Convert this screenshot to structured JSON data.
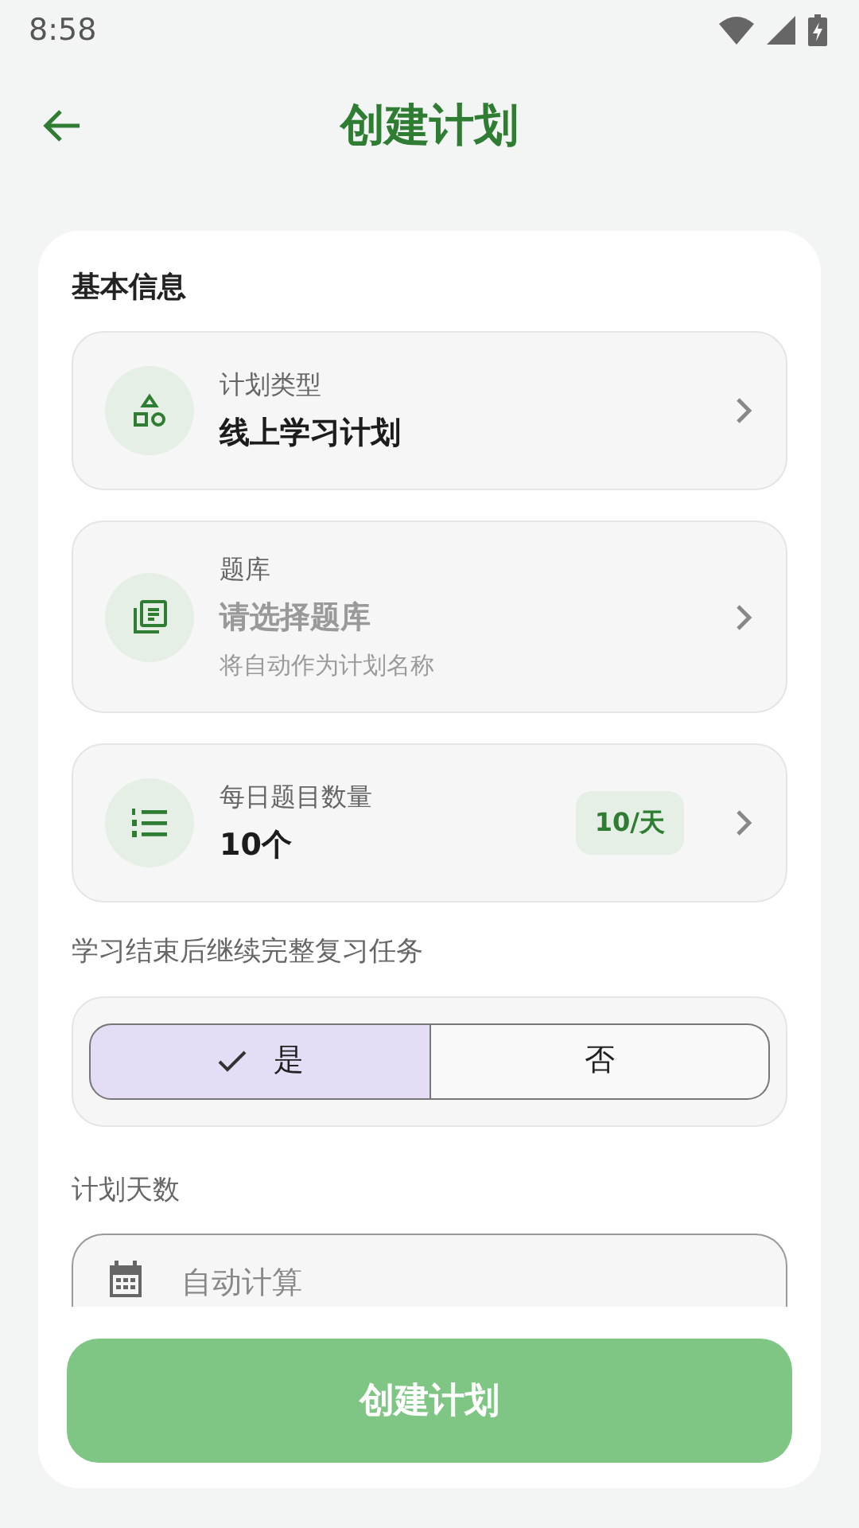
{
  "status_bar": {
    "time": "8:58"
  },
  "header": {
    "title": "创建计划"
  },
  "section_title": "基本信息",
  "fields": [
    {
      "label": "计划类型",
      "value": "线上学习计划"
    },
    {
      "label": "题库",
      "placeholder": "请选择题库",
      "hint": "将自动作为计划名称"
    },
    {
      "label": "每日题目数量",
      "value": "10个",
      "badge": "10/天"
    }
  ],
  "review": {
    "label": "学习结束后继续完整复习任务",
    "options": [
      {
        "label": "是",
        "selected": true
      },
      {
        "label": "否",
        "selected": false
      }
    ]
  },
  "days": {
    "label": "计划天数",
    "placeholder": "自动计算"
  },
  "submit": {
    "label": "创建计划",
    "disabled": true
  }
}
